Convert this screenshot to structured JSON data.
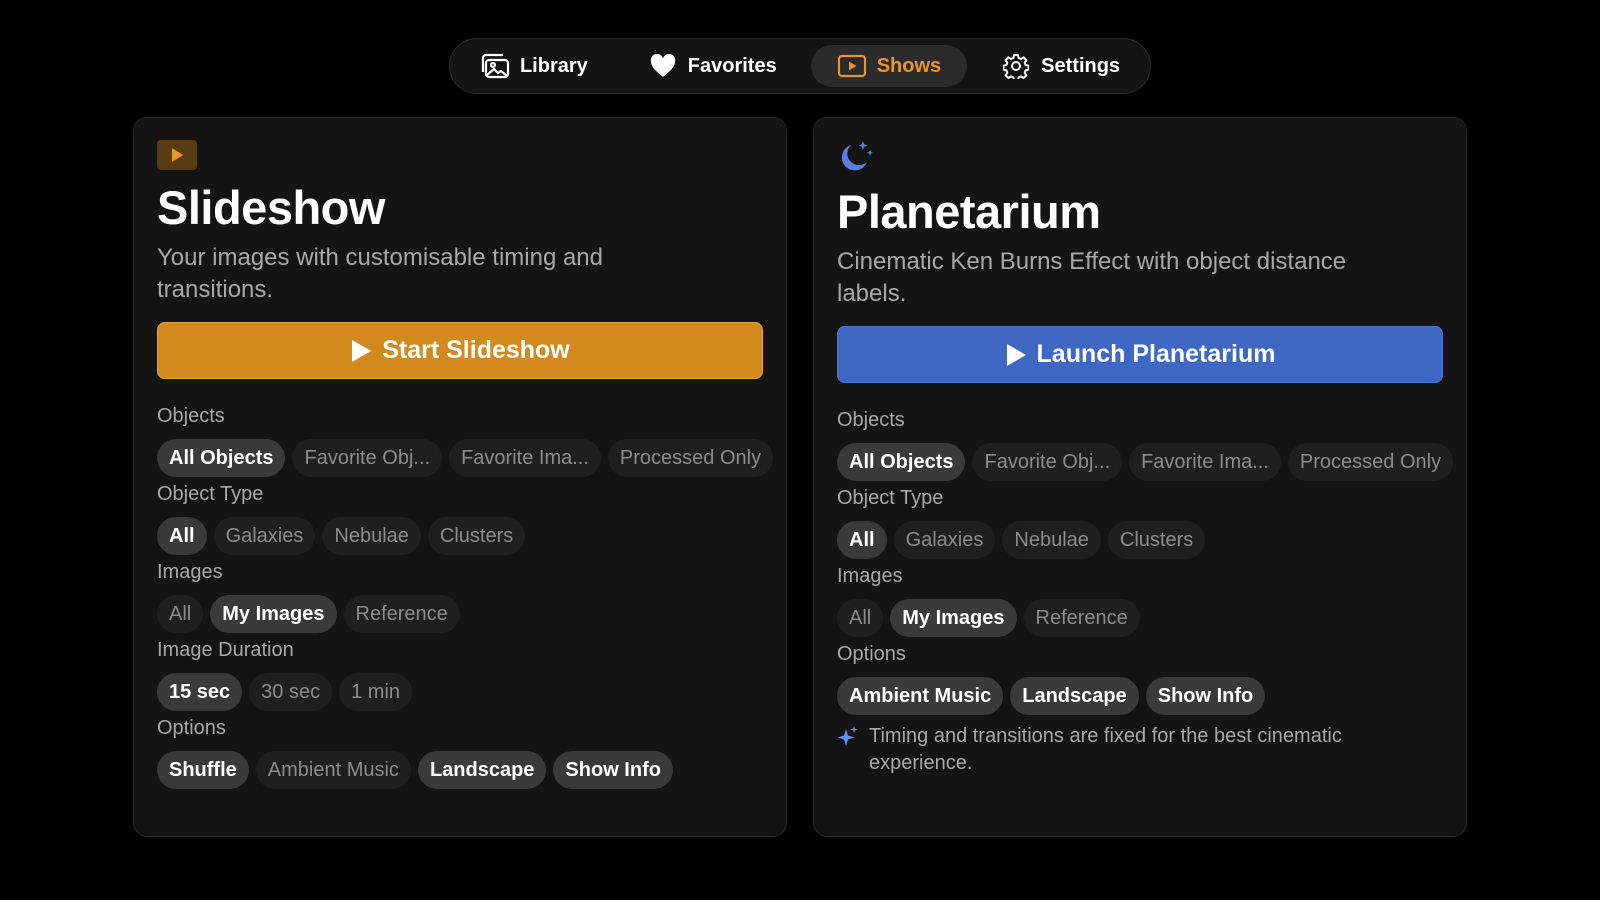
{
  "nav": {
    "items": [
      {
        "label": "Library",
        "icon": "photo-library-icon",
        "active": false
      },
      {
        "label": "Favorites",
        "icon": "heart-icon",
        "active": false
      },
      {
        "label": "Shows",
        "icon": "play-rectangle-icon",
        "active": true
      },
      {
        "label": "Settings",
        "icon": "gear-icon",
        "active": false
      }
    ]
  },
  "colors": {
    "accent_orange": "#d28a1c",
    "accent_blue": "#3e68c4",
    "active_nav_text": "#e8962a",
    "moon_icon": "#5a7fe0"
  },
  "slideshow": {
    "icon": "play-rectangle-icon",
    "title": "Slideshow",
    "description": "Your images with customisable timing and transitions.",
    "button_label": "Start Slideshow",
    "sections": {
      "objects": {
        "label": "Objects",
        "options": [
          "All Objects",
          "Favorite Obj...",
          "Favorite Ima...",
          "Processed Only"
        ],
        "selected": [
          "All Objects"
        ]
      },
      "object_type": {
        "label": "Object Type",
        "options": [
          "All",
          "Galaxies",
          "Nebulae",
          "Clusters"
        ],
        "selected": [
          "All"
        ]
      },
      "images": {
        "label": "Images",
        "options": [
          "All",
          "My Images",
          "Reference"
        ],
        "selected": [
          "My Images"
        ]
      },
      "duration": {
        "label": "Image Duration",
        "options": [
          "15 sec",
          "30 sec",
          "1 min"
        ],
        "selected": [
          "15 sec"
        ]
      },
      "options": {
        "label": "Options",
        "options": [
          "Shuffle",
          "Ambient Music",
          "Landscape",
          "Show Info"
        ],
        "selected": [
          "Shuffle",
          "Landscape",
          "Show Info"
        ]
      }
    }
  },
  "planetarium": {
    "icon": "moon-stars-icon",
    "title": "Planetarium",
    "description": "Cinematic Ken Burns Effect with object distance labels.",
    "button_label": "Launch Planetarium",
    "sections": {
      "objects": {
        "label": "Objects",
        "options": [
          "All Objects",
          "Favorite Obj...",
          "Favorite Ima...",
          "Processed Only"
        ],
        "selected": [
          "All Objects"
        ]
      },
      "object_type": {
        "label": "Object Type",
        "options": [
          "All",
          "Galaxies",
          "Nebulae",
          "Clusters"
        ],
        "selected": [
          "All"
        ]
      },
      "images": {
        "label": "Images",
        "options": [
          "All",
          "My Images",
          "Reference"
        ],
        "selected": [
          "My Images"
        ]
      },
      "options": {
        "label": "Options",
        "options": [
          "Ambient Music",
          "Landscape",
          "Show Info"
        ],
        "selected": [
          "Ambient Music",
          "Landscape",
          "Show Info"
        ]
      }
    },
    "note": "Timing and transitions are fixed for the best cinematic experience."
  }
}
